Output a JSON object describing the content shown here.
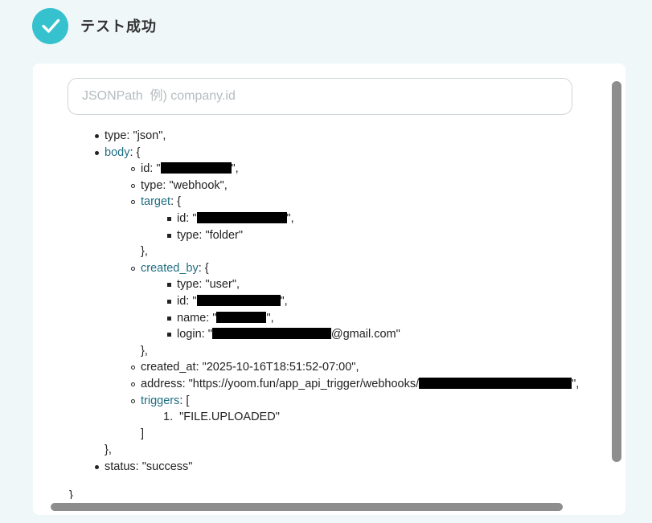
{
  "header": {
    "title": "テスト成功",
    "icon": "check-icon",
    "accent": "#35c1cd"
  },
  "search": {
    "placeholder": "JSONPath  例) company.id",
    "value": ""
  },
  "tree": {
    "type_line": "type: \"json\",",
    "body_key": "body",
    "body_open": ": {",
    "body_id_prefix": "id: \"",
    "body_id_suffix": "\",",
    "body_type": "type: \"webhook\",",
    "target_key": "target",
    "target_open": ": {",
    "target_id_prefix": "id: \"",
    "target_id_suffix": "\",",
    "target_type": "type: \"folder\"",
    "target_close": "},",
    "created_by_key": "created_by",
    "created_by_open": ": {",
    "created_by_type": "type: \"user\",",
    "created_by_id_prefix": "id: \"",
    "created_by_id_suffix": "\",",
    "created_by_name_prefix": "name: \"",
    "created_by_name_suffix": "\",",
    "created_by_login_prefix": "login: \"",
    "created_by_login_suffix": "@gmail.com\"",
    "created_by_close": "},",
    "created_at": "created_at: \"2025-10-16T18:51:52-07:00\",",
    "address_prefix": "address: \"https://yoom.fun/app_api_trigger/webhooks/",
    "address_suffix": "\",",
    "triggers_key": "triggers",
    "triggers_open": ": [",
    "trigger_item_number": "1.",
    "trigger_item": "\"FILE.UPLOADED\"",
    "triggers_close": "]",
    "body_close": "},",
    "status_line": "status: \"success\"",
    "root_close": "}"
  }
}
